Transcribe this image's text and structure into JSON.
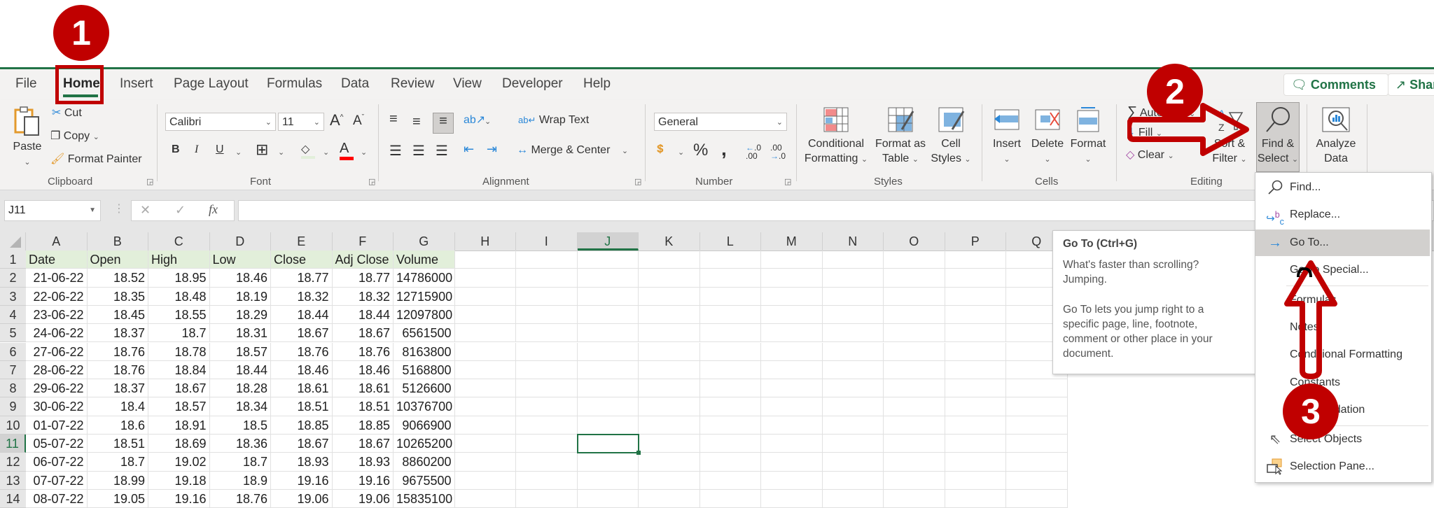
{
  "ribbon_tabs": [
    "File",
    "Home",
    "Insert",
    "Page Layout",
    "Formulas",
    "Data",
    "Review",
    "View",
    "Developer",
    "Help"
  ],
  "active_tab": "Home",
  "top_buttons": {
    "comments": "Comments",
    "share": "Share"
  },
  "clipboard": {
    "paste": "Paste",
    "cut": "Cut",
    "copy": "Copy",
    "format_painter": "Format Painter",
    "label": "Clipboard"
  },
  "font": {
    "name": "Calibri",
    "size": "11",
    "bold": "B",
    "italic": "I",
    "underline": "U",
    "label": "Font",
    "fill_color": "#ffff00",
    "font_color": "#ff0000"
  },
  "alignment": {
    "wrap_text": "Wrap Text",
    "merge_center": "Merge & Center",
    "label": "Alignment"
  },
  "number": {
    "format": "General",
    "percent": "%",
    "comma": ",",
    "label": "Number"
  },
  "styles": {
    "conditional_formatting": [
      "Conditional",
      "Formatting"
    ],
    "format_as_table": [
      "Format as",
      "Table"
    ],
    "cell_styles": [
      "Cell",
      "Styles"
    ],
    "label": "Styles"
  },
  "cells": {
    "insert": "Insert",
    "delete": "Delete",
    "format": "Format",
    "label": "Cells"
  },
  "editing": {
    "autosum": "AutoSum",
    "fill": "Fill",
    "clear": "Clear",
    "sort_filter": [
      "Sort &",
      "Filter"
    ],
    "find_select": [
      "Find &",
      "Select"
    ],
    "label": "Editing"
  },
  "analysis": {
    "analyze_data": [
      "Analyze",
      "Data"
    ]
  },
  "formula_bar": {
    "name_box": "J11",
    "formula": "",
    "fx": "fx"
  },
  "columns": [
    "A",
    "B",
    "C",
    "D",
    "E",
    "F",
    "G",
    "H",
    "I",
    "J",
    "K",
    "L",
    "M",
    "N",
    "O",
    "P",
    "Q"
  ],
  "selected_column": "J",
  "selected_row": 11,
  "active_cell": "J11",
  "table": {
    "headers": [
      "Date",
      "Open",
      "High",
      "Low",
      "Close",
      "Adj Close",
      "Volume"
    ],
    "rows": [
      [
        "21-06-22",
        "18.52",
        "18.95",
        "18.46",
        "18.77",
        "18.77",
        "14786000"
      ],
      [
        "22-06-22",
        "18.35",
        "18.48",
        "18.19",
        "18.32",
        "18.32",
        "12715900"
      ],
      [
        "23-06-22",
        "18.45",
        "18.55",
        "18.29",
        "18.44",
        "18.44",
        "12097800"
      ],
      [
        "24-06-22",
        "18.37",
        "18.7",
        "18.31",
        "18.67",
        "18.67",
        "6561500"
      ],
      [
        "27-06-22",
        "18.76",
        "18.78",
        "18.57",
        "18.76",
        "18.76",
        "8163800"
      ],
      [
        "28-06-22",
        "18.76",
        "18.84",
        "18.44",
        "18.46",
        "18.46",
        "5168800"
      ],
      [
        "29-06-22",
        "18.37",
        "18.67",
        "18.28",
        "18.61",
        "18.61",
        "5126600"
      ],
      [
        "30-06-22",
        "18.4",
        "18.57",
        "18.34",
        "18.51",
        "18.51",
        "10376700"
      ],
      [
        "01-07-22",
        "18.6",
        "18.91",
        "18.5",
        "18.85",
        "18.85",
        "9066900"
      ],
      [
        "05-07-22",
        "18.51",
        "18.69",
        "18.36",
        "18.67",
        "18.67",
        "10265200"
      ],
      [
        "06-07-22",
        "18.7",
        "19.02",
        "18.7",
        "18.93",
        "18.93",
        "8860200"
      ],
      [
        "07-07-22",
        "18.99",
        "19.18",
        "18.9",
        "19.16",
        "19.16",
        "9675500"
      ],
      [
        "08-07-22",
        "19.05",
        "19.16",
        "18.76",
        "19.06",
        "19.06",
        "15835100"
      ]
    ]
  },
  "tooltip": {
    "title": "Go To (Ctrl+G)",
    "lines": [
      "What's faster than scrolling?",
      "Jumping.",
      "",
      "Go To lets you jump right to a",
      "specific page, line, footnote,",
      "comment or other place in your",
      "document."
    ]
  },
  "find_select_menu": {
    "items": [
      {
        "label": "Find...",
        "icon": "magnifier-icon"
      },
      {
        "label": "Replace...",
        "icon": "replace-icon"
      },
      {
        "label": "Go To...",
        "icon": "arrow-right-icon",
        "highlighted": true
      },
      {
        "label": "Go To Special...",
        "icon": ""
      },
      {
        "label": "Formulas",
        "icon": ""
      },
      {
        "label": "Notes",
        "icon": ""
      },
      {
        "label": "Conditional Formatting",
        "icon": ""
      },
      {
        "label": "Constants",
        "icon": ""
      },
      {
        "label": "Data Validation",
        "icon": ""
      },
      {
        "label": "Select Objects",
        "icon": "pointer-icon"
      },
      {
        "label": "Selection Pane...",
        "icon": "selection-pane-icon"
      }
    ]
  },
  "annotations": {
    "step1": "1",
    "step2": "2",
    "step3": "3",
    "color": "#c00000"
  },
  "theme": {
    "accent": "#217346",
    "header_fill": "#e2efda",
    "annotation": "#c00000"
  }
}
